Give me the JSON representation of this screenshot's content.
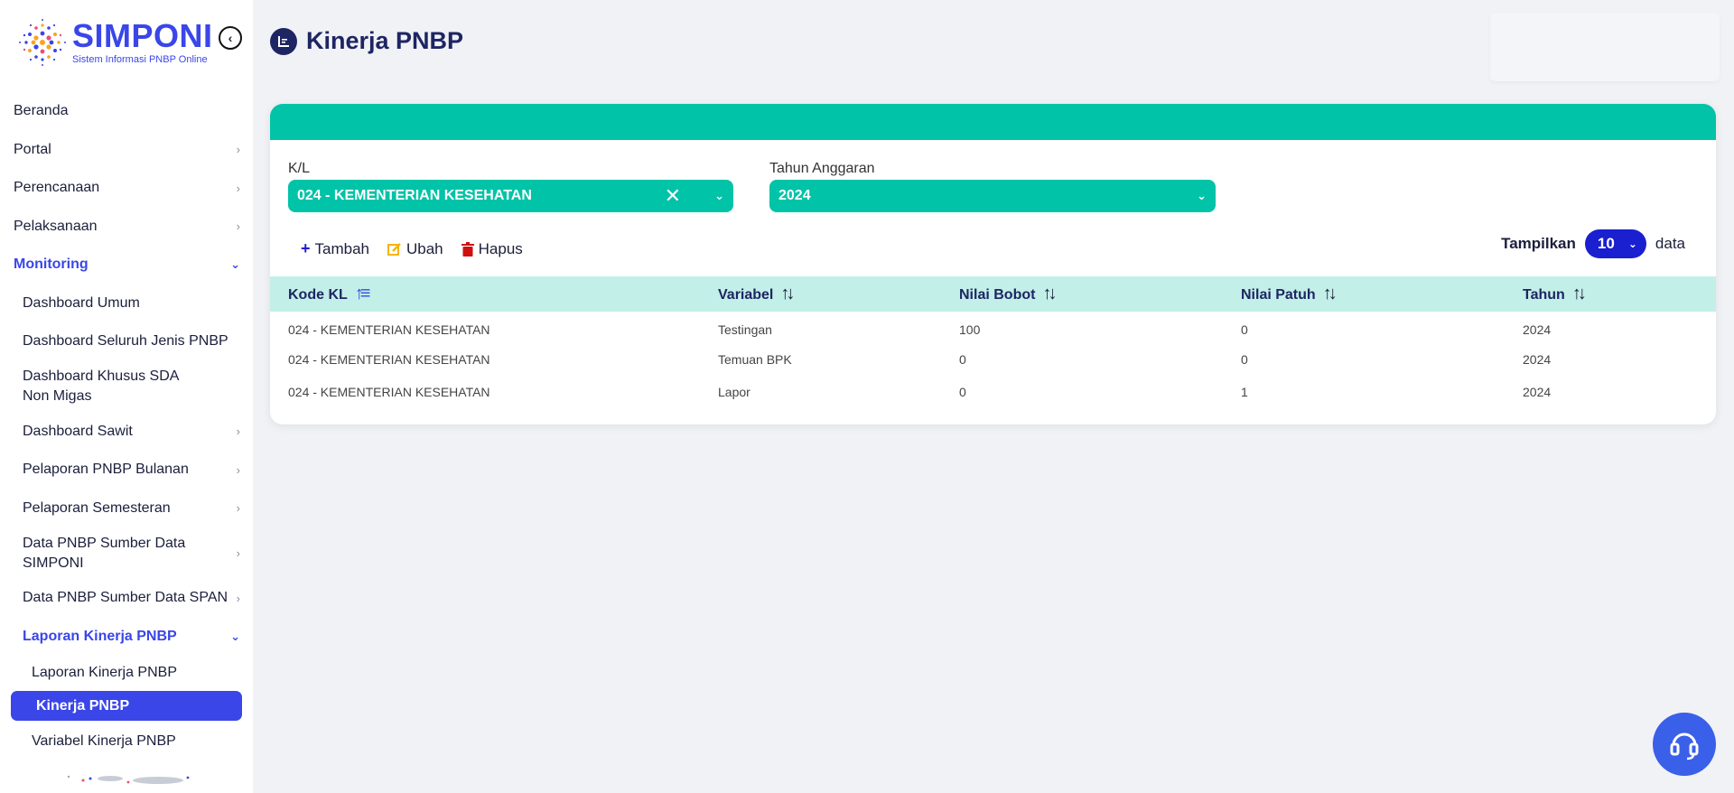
{
  "brand": {
    "title": "SIMPONI",
    "subtitle": "Sistem Informasi PNBP Online"
  },
  "sidebar": {
    "items": [
      {
        "label": "Beranda",
        "level": 0
      },
      {
        "label": "Portal",
        "level": 0
      },
      {
        "label": "Perencanaan",
        "level": 0
      },
      {
        "label": "Pelaksanaan",
        "level": 0
      },
      {
        "label": "Monitoring",
        "level": 0
      },
      {
        "label": "Dashboard Umum",
        "level": 1
      },
      {
        "label": "Dashboard Seluruh Jenis PNBP",
        "level": 1
      },
      {
        "label": "Dashboard Khusus SDA Non Migas",
        "level": 1
      },
      {
        "label": "Dashboard Sawit",
        "level": 1
      },
      {
        "label": "Pelaporan PNBP Bulanan",
        "level": 1
      },
      {
        "label": "Pelaporan Semesteran",
        "level": 1
      },
      {
        "label": "Data PNBP Sumber Data SIMPONI",
        "level": 1
      },
      {
        "label": "Data PNBP Sumber Data SPAN",
        "level": 1
      },
      {
        "label": "Laporan Kinerja PNBP",
        "level": 1
      },
      {
        "label": "Laporan Kinerja PNBP",
        "level": 2
      },
      {
        "label": "Kinerja PNBP",
        "level": 2
      },
      {
        "label": "Variabel Kinerja PNBP",
        "level": 2
      }
    ]
  },
  "page": {
    "title": "Kinerja PNBP"
  },
  "filters": {
    "kl_label": "K/L",
    "kl_value": "024 - KEMENTERIAN KESEHATAN",
    "year_label": "Tahun Anggaran",
    "year_value": "2024"
  },
  "toolbar": {
    "add": "Tambah",
    "edit": "Ubah",
    "delete": "Hapus"
  },
  "page_size": {
    "label": "Tampilkan",
    "value": "10",
    "suffix": "data"
  },
  "table": {
    "columns": [
      "Kode KL",
      "Variabel",
      "Nilai Bobot",
      "Nilai Patuh",
      "Tahun"
    ],
    "rows": [
      [
        "024 - KEMENTERIAN KESEHATAN",
        "Testingan",
        "100",
        "0",
        "2024"
      ],
      [
        "024 - KEMENTERIAN KESEHATAN",
        "Temuan BPK",
        "0",
        "0",
        "2024"
      ],
      [
        "024 - KEMENTERIAN KESEHATAN",
        "Lapor",
        "0",
        "1",
        "2024"
      ]
    ]
  },
  "colors": {
    "accent": "#3a46e8",
    "teal": "#01c3a8",
    "navy": "#1e2563",
    "header_row": "#c2efe8"
  }
}
